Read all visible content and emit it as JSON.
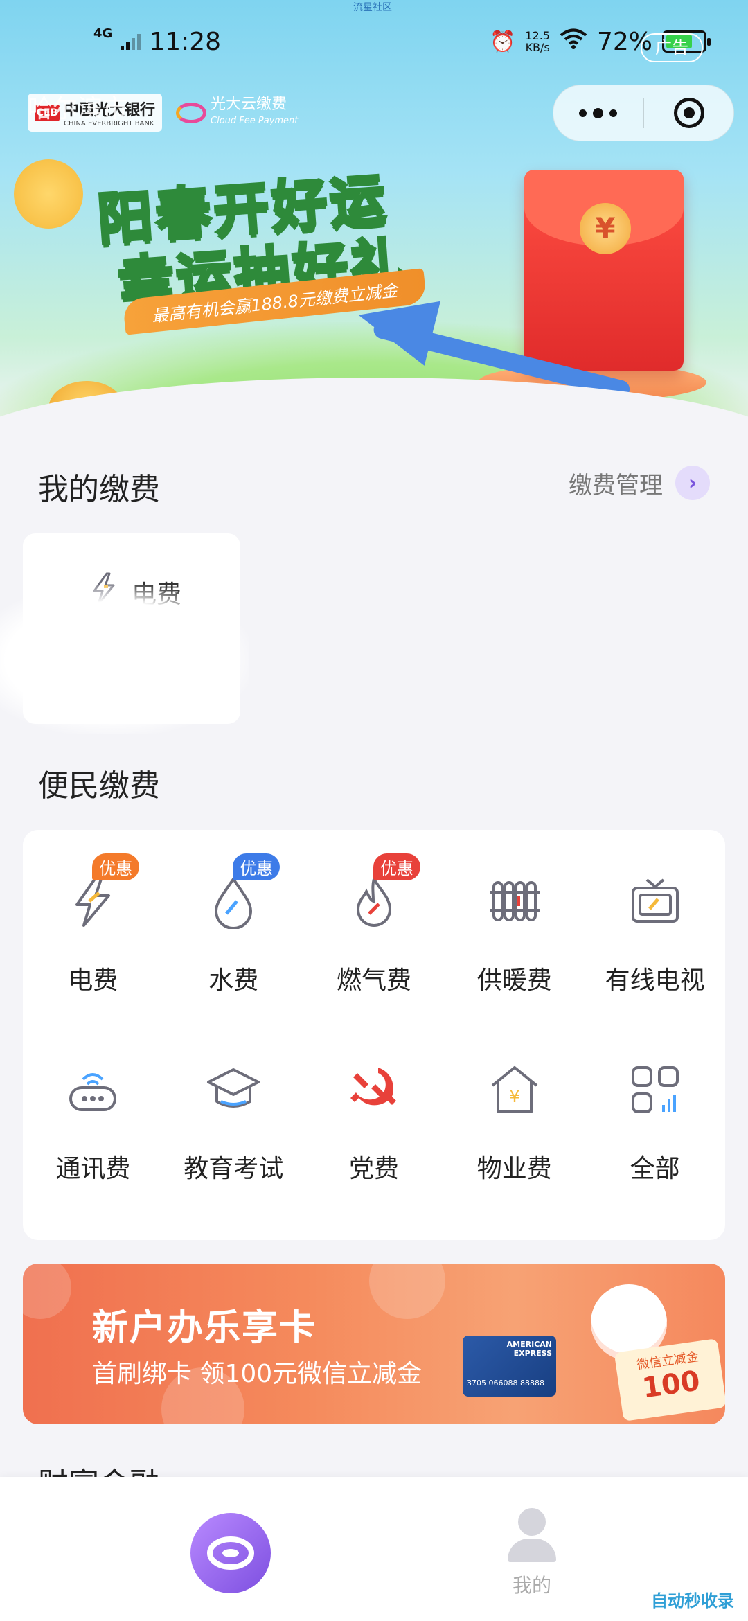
{
  "status_bar": {
    "network": "4G",
    "time": "11:28",
    "net_speed_value": "12.5",
    "net_speed_unit": "KB/s",
    "battery_percent": "72%",
    "battery_level": 0.72,
    "top_tiny_text": "流星社区"
  },
  "header": {
    "brand_overlay_text": "哈尔滨市",
    "bank_name": "中国光大银行",
    "bank_name_en": "CHINA EVERBRIGHT BANK",
    "cloud_name": "光大云缴费",
    "cloud_name_en": "Cloud Fee Payment",
    "ad_tag": "广告"
  },
  "banner": {
    "title_line1": "阳春开好运",
    "title_line2": "幸运抽好礼",
    "ribbon": "最高有机会赢188.8元缴费立减金",
    "coin_symbol": "¥",
    "dot_count": 6,
    "active_dot": 0
  },
  "my_payments": {
    "title": "我的缴费",
    "manage_label": "缴费管理",
    "items": [
      {
        "label": "电费",
        "icon": "lightning-icon"
      }
    ]
  },
  "convenience": {
    "title": "便民缴费",
    "items": [
      {
        "label": "电费",
        "icon": "lightning-icon",
        "badge": "优惠",
        "badge_color": "#f47a2a"
      },
      {
        "label": "水费",
        "icon": "water-drop-icon",
        "badge": "优惠",
        "badge_color": "#3d7be8"
      },
      {
        "label": "燃气费",
        "icon": "flame-icon",
        "badge": "优惠",
        "badge_color": "#e8413a"
      },
      {
        "label": "供暖费",
        "icon": "radiator-icon",
        "badge": "",
        "badge_color": ""
      },
      {
        "label": "有线电视",
        "icon": "tv-icon",
        "badge": "",
        "badge_color": ""
      },
      {
        "label": "通讯费",
        "icon": "router-icon",
        "badge": "",
        "badge_color": ""
      },
      {
        "label": "教育考试",
        "icon": "graduation-cap-icon",
        "badge": "",
        "badge_color": ""
      },
      {
        "label": "党费",
        "icon": "party-emblem-icon",
        "badge": "",
        "badge_color": ""
      },
      {
        "label": "物业费",
        "icon": "house-icon",
        "badge": "",
        "badge_color": ""
      },
      {
        "label": "全部",
        "icon": "grid-all-icon",
        "badge": "",
        "badge_color": ""
      }
    ]
  },
  "promo": {
    "headline": "新户办乐享卡",
    "subline": "首刷绑卡 领100元微信立减金",
    "card_brand": "AMERICAN EXPRESS",
    "card_number": "3705 066088 88888",
    "coupon_title": "微信立减金",
    "coupon_value": "100"
  },
  "next_section": {
    "title": "财富金融"
  },
  "tabbar": {
    "me_label": "我的"
  },
  "watermark": {
    "text": "自动秒收录"
  },
  "colors": {
    "accent": "#8f6be8",
    "icon_gray": "#6d6d7a",
    "icon_red": "#e8413a",
    "icon_orange": "#f5b93a"
  }
}
